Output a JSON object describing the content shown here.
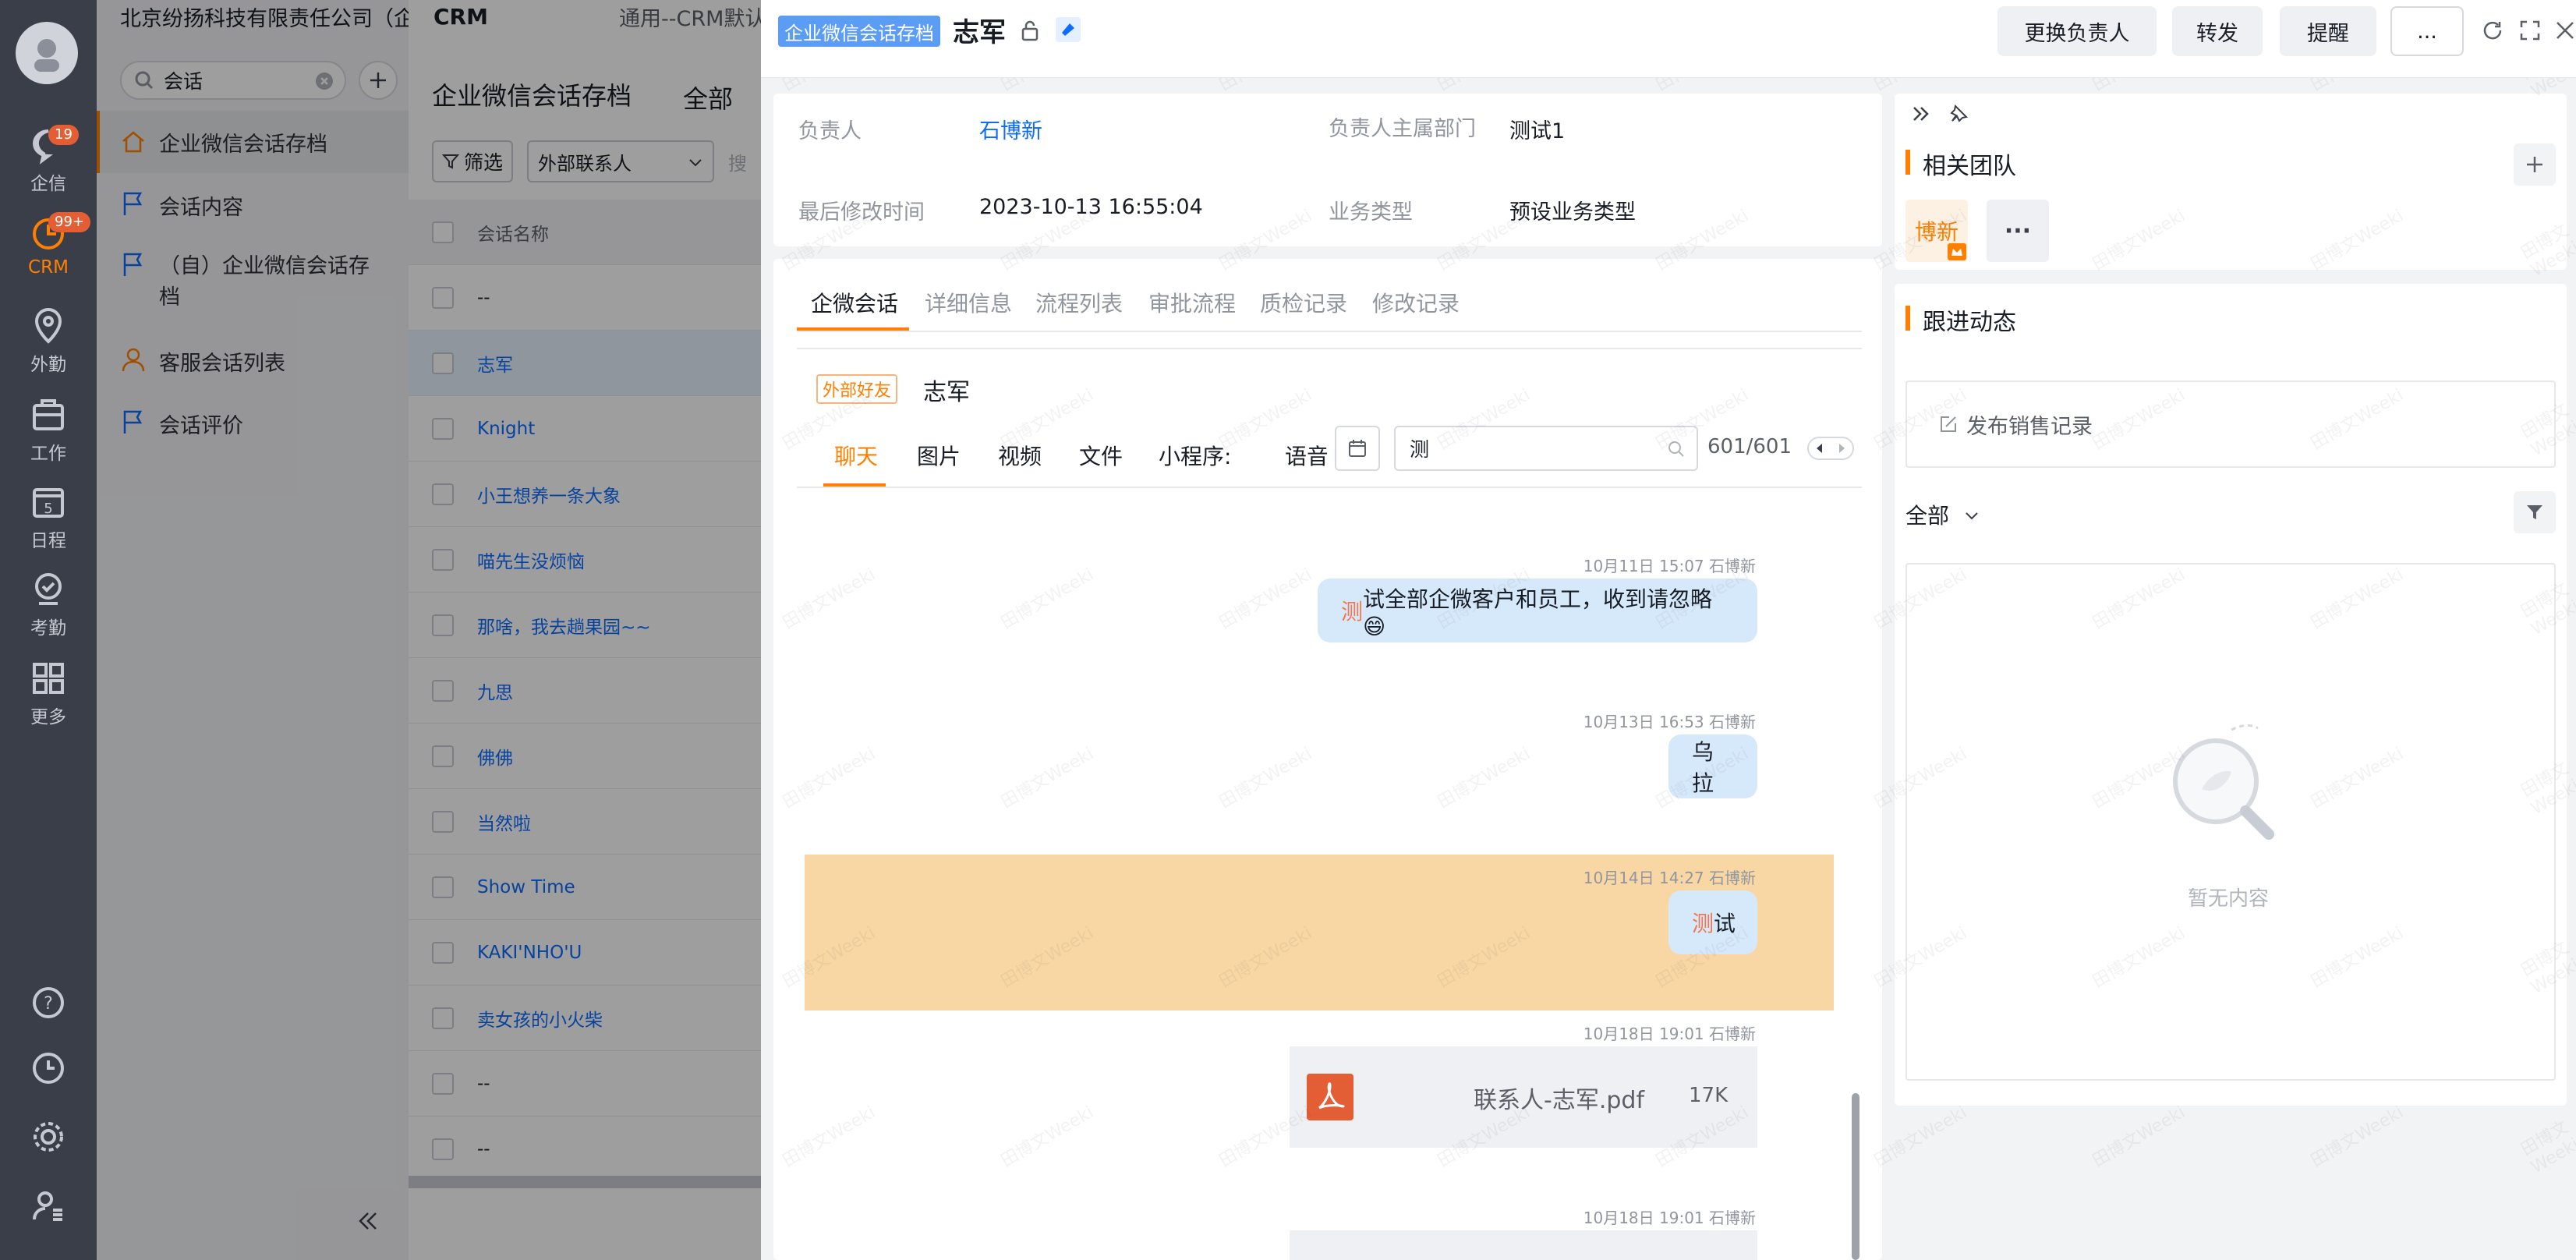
{
  "nav": {
    "badges": {
      "qixin": "19",
      "crm": "99+"
    },
    "items": [
      {
        "label": "企信"
      },
      {
        "label": "CRM"
      },
      {
        "label": "外勤"
      },
      {
        "label": "工作"
      },
      {
        "label": "日程"
      },
      {
        "label": "考勤"
      },
      {
        "label": "更多"
      }
    ],
    "calendar_day": "5"
  },
  "company": {
    "name": "北京纷扬科技有限责任公司（企微）",
    "app": "CRM",
    "view": "通用--CRM默认"
  },
  "search": {
    "value": "会话"
  },
  "sidebar": {
    "items": [
      {
        "label": "企业微信会话存档"
      },
      {
        "label": "会话内容"
      },
      {
        "label": "（自）企业微信会话存档"
      },
      {
        "label": "客服会话列表"
      },
      {
        "label": "会话评价"
      }
    ]
  },
  "list": {
    "title": "企业微信会话存档",
    "scope": "全部",
    "filter_label": "筛选",
    "type_select": "外部联系人",
    "search_placeholder": "搜",
    "col_header": "会话名称",
    "rows": [
      "--",
      "志军",
      "Knight",
      "小王想养一条大象",
      "喵先生没烦恼",
      "那啥，我去趟果园~~",
      "九思",
      "佛佛",
      "当然啦",
      "Show Time",
      "KAKI'NHO'U",
      "卖女孩的小火柴",
      "--",
      "--"
    ]
  },
  "detail": {
    "object_tag": "企业微信会话存档",
    "title": "志军",
    "actions": [
      "更换负责人",
      "转发",
      "提醒",
      "..."
    ],
    "fields": {
      "owner_label": "负责人",
      "owner": "石博新",
      "dept_label": "负责人主属部门",
      "dept": "测试1",
      "modified_label": "最后修改时间",
      "modified": "2023-10-13 16:55:04",
      "biz_label": "业务类型",
      "biz": "预设业务类型"
    },
    "tabs": [
      "企微会话",
      "详细信息",
      "流程列表",
      "审批流程",
      "质检记录",
      "修改记录"
    ],
    "contact_tag": "外部好友",
    "contact_name": "志军",
    "chat_tabs": [
      "聊天",
      "图片",
      "视频",
      "文件",
      "小程序:",
      "语音"
    ],
    "chat_search": "测",
    "match_count": "601/601",
    "messages": [
      {
        "meta": "10月11日 15:07 石博新",
        "hl": "测",
        "text": "试全部企微客户和员工，收到请忽略😄"
      },
      {
        "meta": "10月13日 16:53 石博新",
        "hl": "",
        "text": "乌拉"
      },
      {
        "meta": "10月14日 14:27 石博新",
        "hl": "测",
        "text": "试"
      },
      {
        "meta": "10月18日 19:01 石博新",
        "file_name": "联系人-志军.pdf",
        "file_size": "17K"
      },
      {
        "meta": "10月18日 19:01 石博新"
      }
    ]
  },
  "side": {
    "team_title": "相关团队",
    "member": "博新",
    "follow_title": "跟进动态",
    "post_placeholder": "发布销售记录",
    "filter_all": "全部",
    "empty": "暂无内容"
  },
  "watermark": "田博文Weeki",
  "colors": {
    "accent": "#ff8000",
    "link": "#0c6cff",
    "nav": "#3a3e49",
    "highlight": "#f8d7a5"
  }
}
